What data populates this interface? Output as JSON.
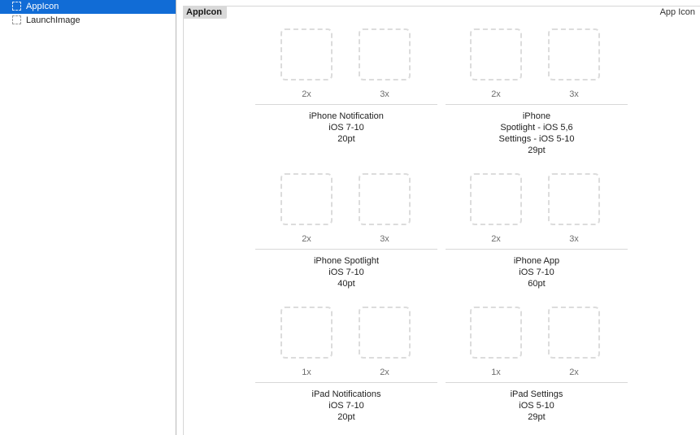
{
  "sidebar": {
    "items": [
      {
        "label": "AppIcon",
        "selected": true
      },
      {
        "label": "LaunchImage",
        "selected": false
      }
    ]
  },
  "editor": {
    "set_title": "AppIcon",
    "set_type": "App Icon"
  },
  "groups": [
    {
      "slots": [
        "2x",
        "3x"
      ],
      "caption": [
        "iPhone Notification",
        "iOS 7-10",
        "20pt"
      ]
    },
    {
      "slots": [
        "2x",
        "3x"
      ],
      "caption": [
        "iPhone",
        "Spotlight - iOS 5,6",
        "Settings - iOS 5-10",
        "29pt"
      ]
    },
    {
      "slots": [
        "2x",
        "3x"
      ],
      "caption": [
        "iPhone Spotlight",
        "iOS 7-10",
        "40pt"
      ]
    },
    {
      "slots": [
        "2x",
        "3x"
      ],
      "caption": [
        "iPhone App",
        "iOS 7-10",
        "60pt"
      ]
    },
    {
      "slots": [
        "1x",
        "2x"
      ],
      "caption": [
        "iPad Notifications",
        "iOS 7-10",
        "20pt"
      ]
    },
    {
      "slots": [
        "1x",
        "2x"
      ],
      "caption": [
        "iPad Settings",
        "iOS 5-10",
        "29pt"
      ]
    }
  ],
  "colors": {
    "selection": "#116cd6",
    "set_title_bg": "#d9d9d9",
    "slot_border": "#dcdcdc"
  }
}
